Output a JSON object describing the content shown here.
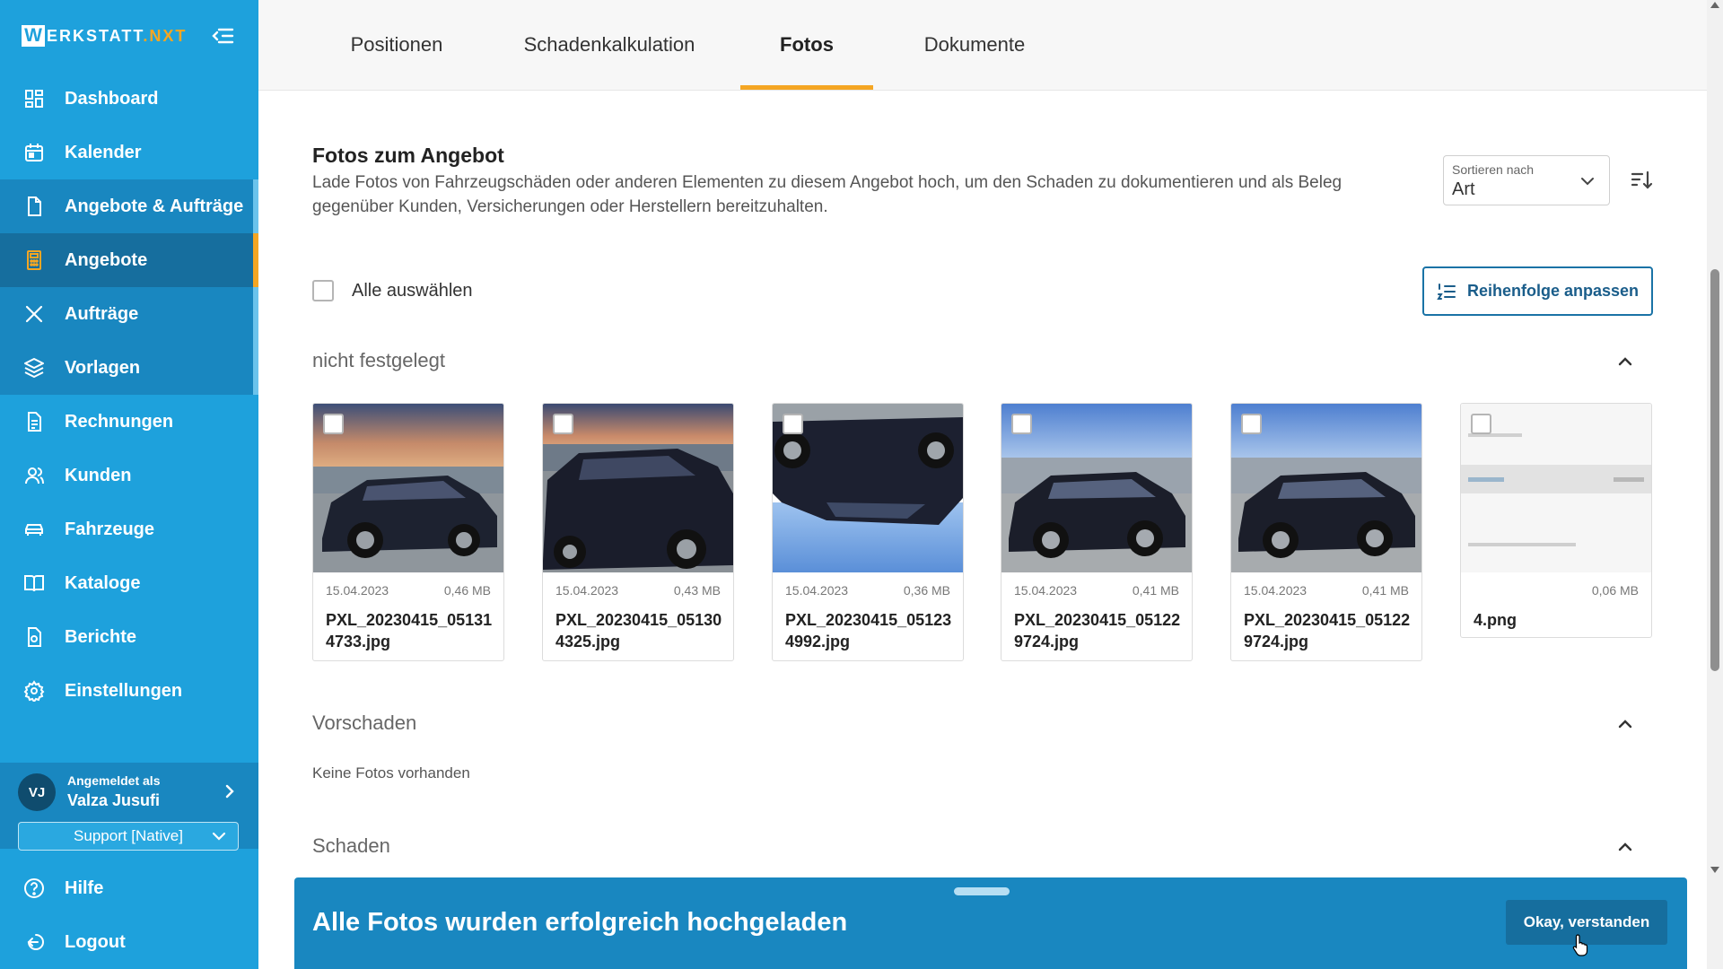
{
  "app": {
    "logo_letter": "W",
    "logo_main": "ERKSTATT",
    "logo_accent": ".NXT",
    "brand_color": "#1ea1dc",
    "accent_color": "#f5a623"
  },
  "sidebar": {
    "items": [
      {
        "label": "Dashboard",
        "icon": "dashboard-icon"
      },
      {
        "label": "Kalender",
        "icon": "calendar-icon"
      },
      {
        "label": "Angebote & Aufträge",
        "icon": "document-icon"
      },
      {
        "label": "Angebote",
        "icon": "calculator-icon",
        "active": true
      },
      {
        "label": "Aufträge",
        "icon": "tools-icon"
      },
      {
        "label": "Vorlagen",
        "icon": "layers-icon"
      },
      {
        "label": "Rechnungen",
        "icon": "invoice-icon"
      },
      {
        "label": "Kunden",
        "icon": "users-icon"
      },
      {
        "label": "Fahrzeuge",
        "icon": "car-icon"
      },
      {
        "label": "Kataloge",
        "icon": "book-icon"
      },
      {
        "label": "Berichte",
        "icon": "report-icon"
      },
      {
        "label": "Einstellungen",
        "icon": "gear-icon"
      }
    ],
    "user": {
      "initials": "VJ",
      "caption": "Angemeldet als",
      "name": "Valza Jusufi",
      "role_select": "Support [Native]"
    },
    "bottom_items": [
      {
        "label": "Hilfe",
        "icon": "help-icon"
      },
      {
        "label": "Logout",
        "icon": "logout-icon"
      }
    ]
  },
  "tabs": [
    {
      "label": "Positionen"
    },
    {
      "label": "Schadenkalkulation"
    },
    {
      "label": "Fotos",
      "active": true
    },
    {
      "label": "Dokumente"
    }
  ],
  "photos_section": {
    "title": "Fotos zum Angebot",
    "description": "Lade Fotos von Fahrzeugschäden oder anderen Elementen zu diesem Angebot hoch, um den Schaden zu dokumentieren und als Beleg gegenüber Kunden, Versicherungen oder Herstellern bereitzuhalten.",
    "sort": {
      "label": "Sortieren nach",
      "value": "Art"
    },
    "select_all_label": "Alle auswählen",
    "order_button_label": "Reihenfolge anpassen"
  },
  "groups": [
    {
      "title": "nicht festgelegt",
      "photos": [
        {
          "date": "15.04.2023",
          "size": "0,46 MB",
          "name": "PXL_20230415_051314733.jpg"
        },
        {
          "date": "15.04.2023",
          "size": "0,43 MB",
          "name": "PXL_20230415_051304325.jpg"
        },
        {
          "date": "15.04.2023",
          "size": "0,36 MB",
          "name": "PXL_20230415_051234992.jpg"
        },
        {
          "date": "15.04.2023",
          "size": "0,41 MB",
          "name": "PXL_20230415_051229724.jpg"
        },
        {
          "date": "15.04.2023",
          "size": "0,41 MB",
          "name": "PXL_20230415_051229724.jpg"
        },
        {
          "date": "",
          "size": "0,06 MB",
          "name": "4.png"
        }
      ]
    },
    {
      "title": "Vorschaden",
      "empty_text": "Keine Fotos vorhanden"
    },
    {
      "title": "Schaden"
    }
  ],
  "toast": {
    "message": "Alle Fotos wurden erfolgreich hochgeladen",
    "button_label": "Okay, verstanden"
  }
}
